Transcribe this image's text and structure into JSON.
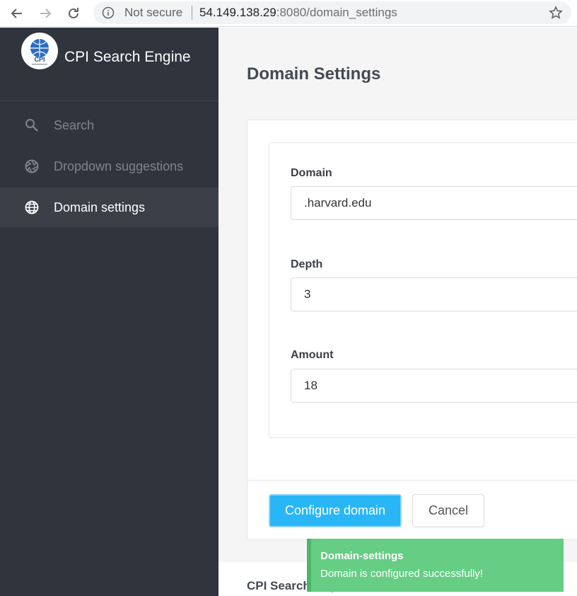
{
  "browser": {
    "security_label": "Not secure",
    "url_host": "54.149.138.29",
    "url_rest": ":8080/domain_settings"
  },
  "sidebar": {
    "brand": "CPI Search Engine",
    "logo_text": "CPI",
    "items": [
      {
        "label": "Search",
        "icon": "search-icon"
      },
      {
        "label": "Dropdown suggestions",
        "icon": "aperture-icon"
      },
      {
        "label": "Domain settings",
        "icon": "globe-icon",
        "active": true
      }
    ]
  },
  "main": {
    "title": "Domain Settings",
    "form": {
      "domain_label": "Domain",
      "domain_value": ".harvard.edu",
      "depth_label": "Depth",
      "depth_value": "3",
      "amount_label": "Amount",
      "amount_value": "18"
    },
    "configure_label": "Configure domain",
    "cancel_label": "Cancel",
    "footer_text": "CPI Search Engine"
  },
  "toast": {
    "title": "Domain-settings",
    "message": "Domain is configured successfully!"
  },
  "colors": {
    "sidebar_bg": "#2f343d",
    "primary": "#29b6f6",
    "toast_bg": "#66cd84"
  }
}
